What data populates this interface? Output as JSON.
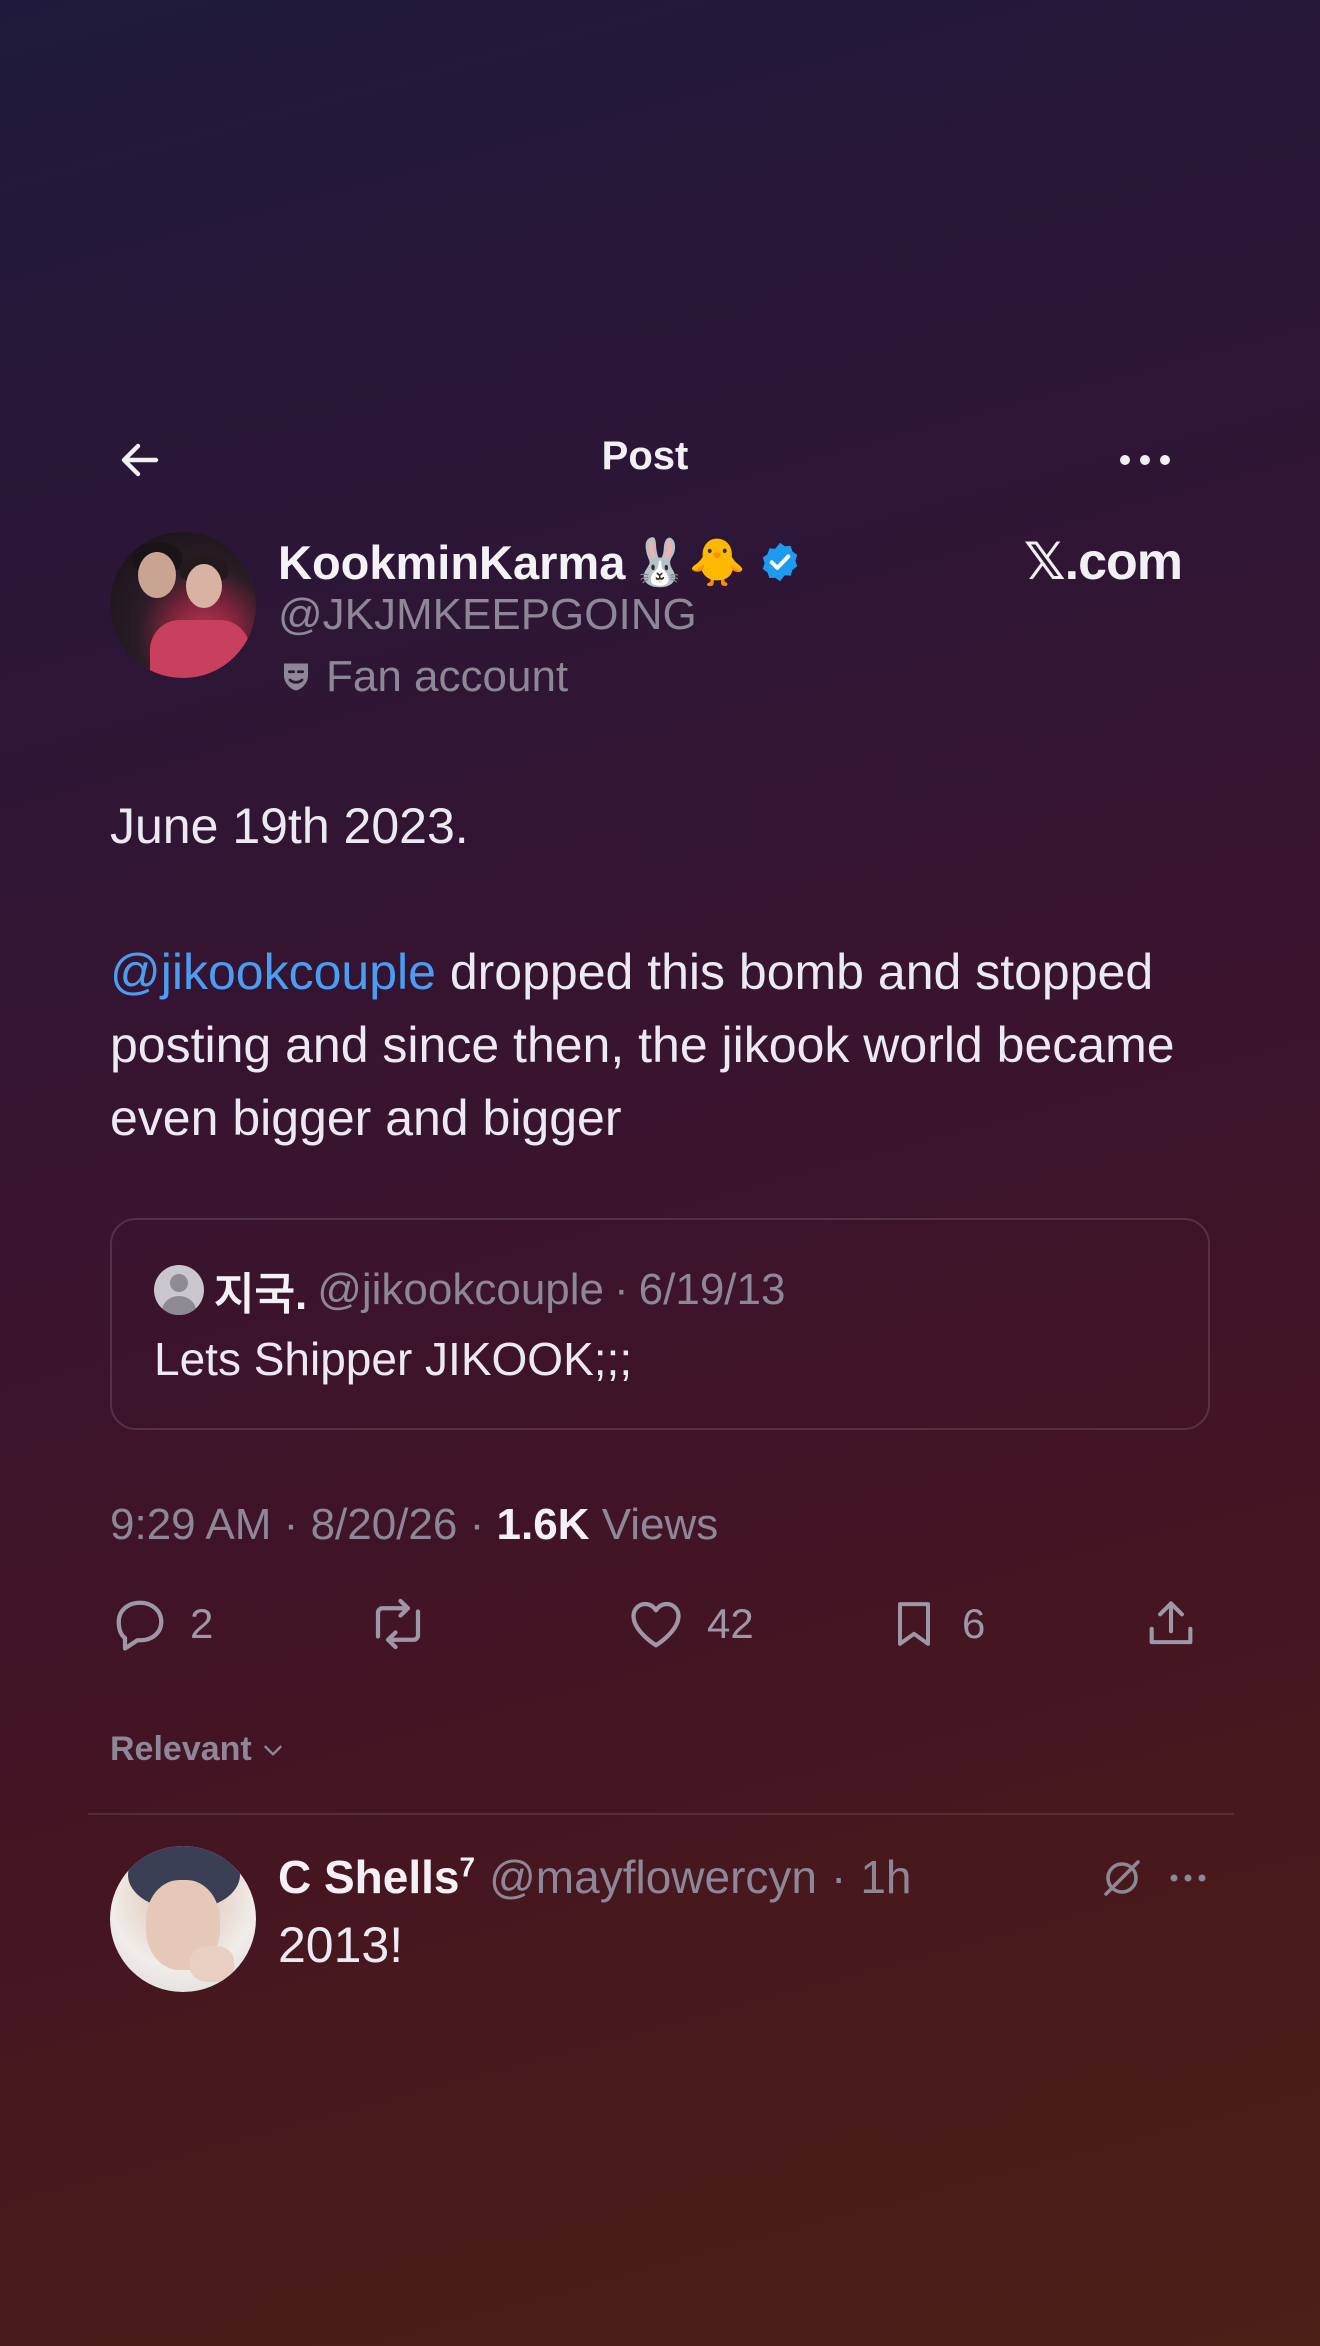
{
  "topbar": {
    "title": "Post"
  },
  "author": {
    "display_name": "KookminKarma",
    "emojis": "🐰🐥",
    "handle": "@JKJMKEEPGOING",
    "label": "Fan account",
    "watermark": "𝕏.com"
  },
  "post": {
    "line1": "June 19th 2023.",
    "mention": "@jikookcouple",
    "text_after_mention": " dropped this bomb and stopped posting and since then, the jikook world became even bigger and bigger"
  },
  "quote": {
    "name": "지국.",
    "handle": "@jikookcouple",
    "separator": "·",
    "date": "6/19/13",
    "text": "Lets Shipper JIKOOK;;;"
  },
  "meta": {
    "time": "9:29 AM",
    "date": "8/20/26",
    "views_count": "1.6K",
    "views_label": "Views",
    "separator": "·"
  },
  "actions": {
    "replies": "2",
    "likes": "42",
    "bookmarks": "6"
  },
  "sort": {
    "label": "Relevant"
  },
  "reply": {
    "name": "C Shells",
    "name_superscript": "7",
    "handle": "@mayflowercyn",
    "separator": "·",
    "time": "1h",
    "text": "2013!"
  },
  "colors": {
    "accent_link": "#4a9df0",
    "verified": "#1d9bf0"
  }
}
